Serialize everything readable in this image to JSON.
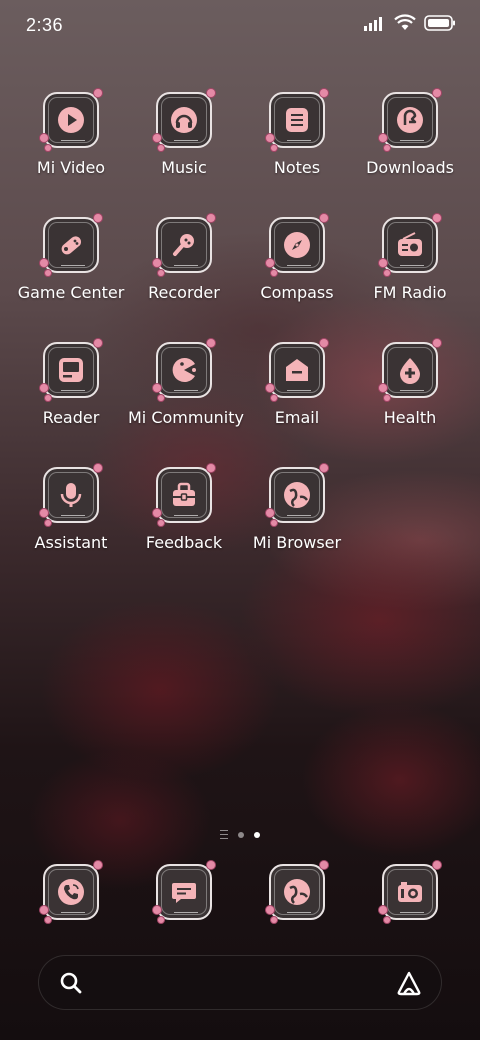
{
  "status_bar": {
    "time": "2:36"
  },
  "apps": [
    {
      "label": "Mi Video",
      "icon": "play-icon"
    },
    {
      "label": "Music",
      "icon": "headphones-icon"
    },
    {
      "label": "Notes",
      "icon": "note-icon"
    },
    {
      "label": "Downloads",
      "icon": "download-icon"
    },
    {
      "label": "Game Center",
      "icon": "gamepad-icon"
    },
    {
      "label": "Recorder",
      "icon": "microphone-icon"
    },
    {
      "label": "Compass",
      "icon": "compass-icon"
    },
    {
      "label": "FM Radio",
      "icon": "radio-icon"
    },
    {
      "label": "Reader",
      "icon": "book-icon"
    },
    {
      "label": "Mi Community",
      "icon": "pacman-icon"
    },
    {
      "label": "Email",
      "icon": "mail-icon"
    },
    {
      "label": "Health",
      "icon": "health-drop-icon"
    },
    {
      "label": "Assistant",
      "icon": "assistant-mic-icon"
    },
    {
      "label": "Feedback",
      "icon": "toolbox-icon"
    },
    {
      "label": "Mi Browser",
      "icon": "globe-icon"
    }
  ],
  "dock": [
    {
      "name": "phone",
      "icon": "phone-icon"
    },
    {
      "name": "messaging",
      "icon": "message-icon"
    },
    {
      "name": "browser",
      "icon": "globe-icon"
    },
    {
      "name": "camera",
      "icon": "camera-icon"
    }
  ],
  "pager": {
    "pages": 2,
    "active": 2
  },
  "colors": {
    "icon_fill": "#f4b4b8",
    "tile_bg": "#3a3334",
    "tile_border": "#e9e3e3",
    "flower": "#e48aa6"
  }
}
